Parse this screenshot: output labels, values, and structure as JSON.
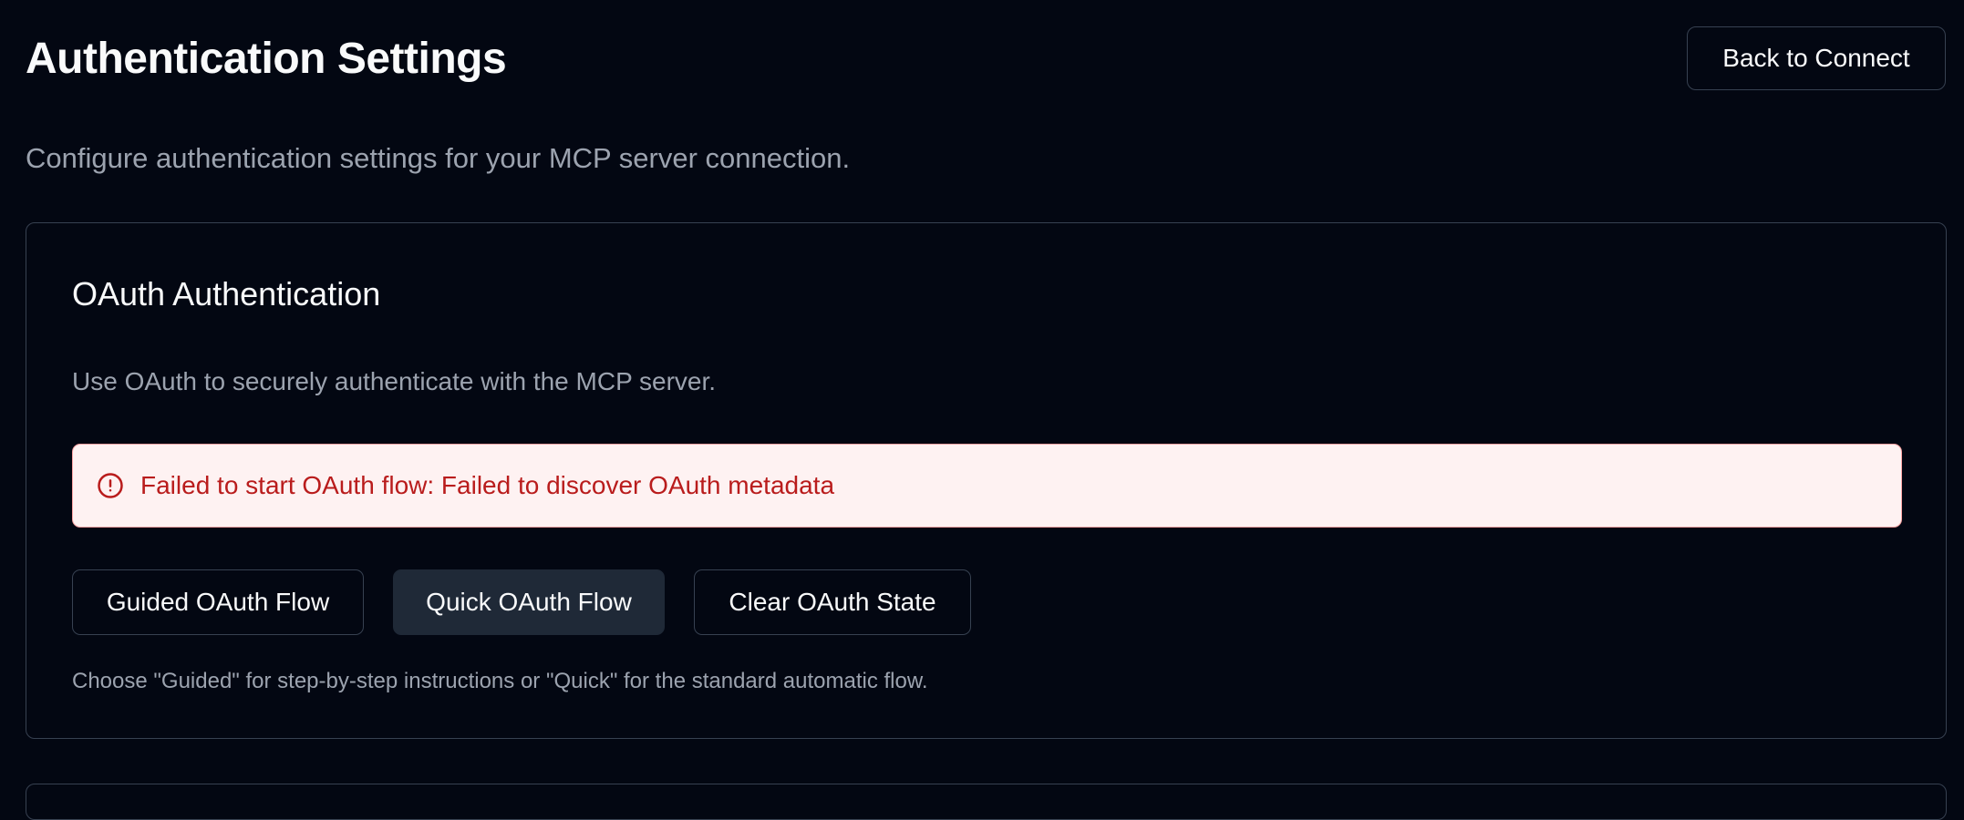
{
  "header": {
    "title": "Authentication Settings",
    "back_button_label": "Back to Connect",
    "description": "Configure authentication settings for your MCP server connection."
  },
  "oauth_card": {
    "title": "OAuth Authentication",
    "description": "Use OAuth to securely authenticate with the MCP server.",
    "error": {
      "icon": "alert-circle-icon",
      "message": "Failed to start OAuth flow: Failed to discover OAuth metadata"
    },
    "buttons": {
      "guided_label": "Guided OAuth Flow",
      "quick_label": "Quick OAuth Flow",
      "clear_label": "Clear OAuth State"
    },
    "hint": "Choose \"Guided\" for step-by-step instructions or \"Quick\" for the standard automatic flow."
  },
  "colors": {
    "background": "#030712",
    "border": "#374151",
    "text_primary": "#f9fafb",
    "text_muted": "#9ca3af",
    "error_bg": "#fef2f2",
    "error_border": "#fca5a5",
    "error_text": "#b91c1c",
    "button_secondary_bg": "#1f2937"
  }
}
